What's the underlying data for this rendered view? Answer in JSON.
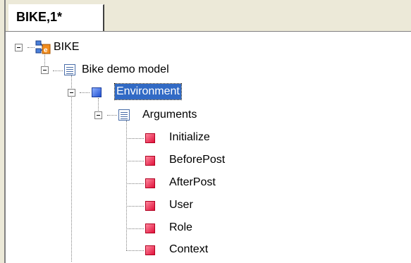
{
  "window": {
    "tab_title": "BIKE,1*"
  },
  "tree": {
    "root": {
      "label": "BIKE",
      "icon": "model-root-icon"
    },
    "model": {
      "label": "Bike demo model",
      "icon": "document-icon"
    },
    "environment": {
      "label": "Environment",
      "icon": "blue-square-icon",
      "selected": true
    },
    "arguments": {
      "label": "Arguments",
      "icon": "document-icon"
    },
    "items": [
      {
        "label": "Initialize",
        "icon": "red-square-icon"
      },
      {
        "label": "BeforePost",
        "icon": "red-square-icon"
      },
      {
        "label": "AfterPost",
        "icon": "red-square-icon"
      },
      {
        "label": "User",
        "icon": "red-square-icon"
      },
      {
        "label": "Role",
        "icon": "red-square-icon"
      },
      {
        "label": "Context",
        "icon": "red-square-icon"
      }
    ]
  },
  "colors": {
    "selection": "#316ac5",
    "item_icon": "#e0103a",
    "environment_icon": "#1f4fd0"
  }
}
